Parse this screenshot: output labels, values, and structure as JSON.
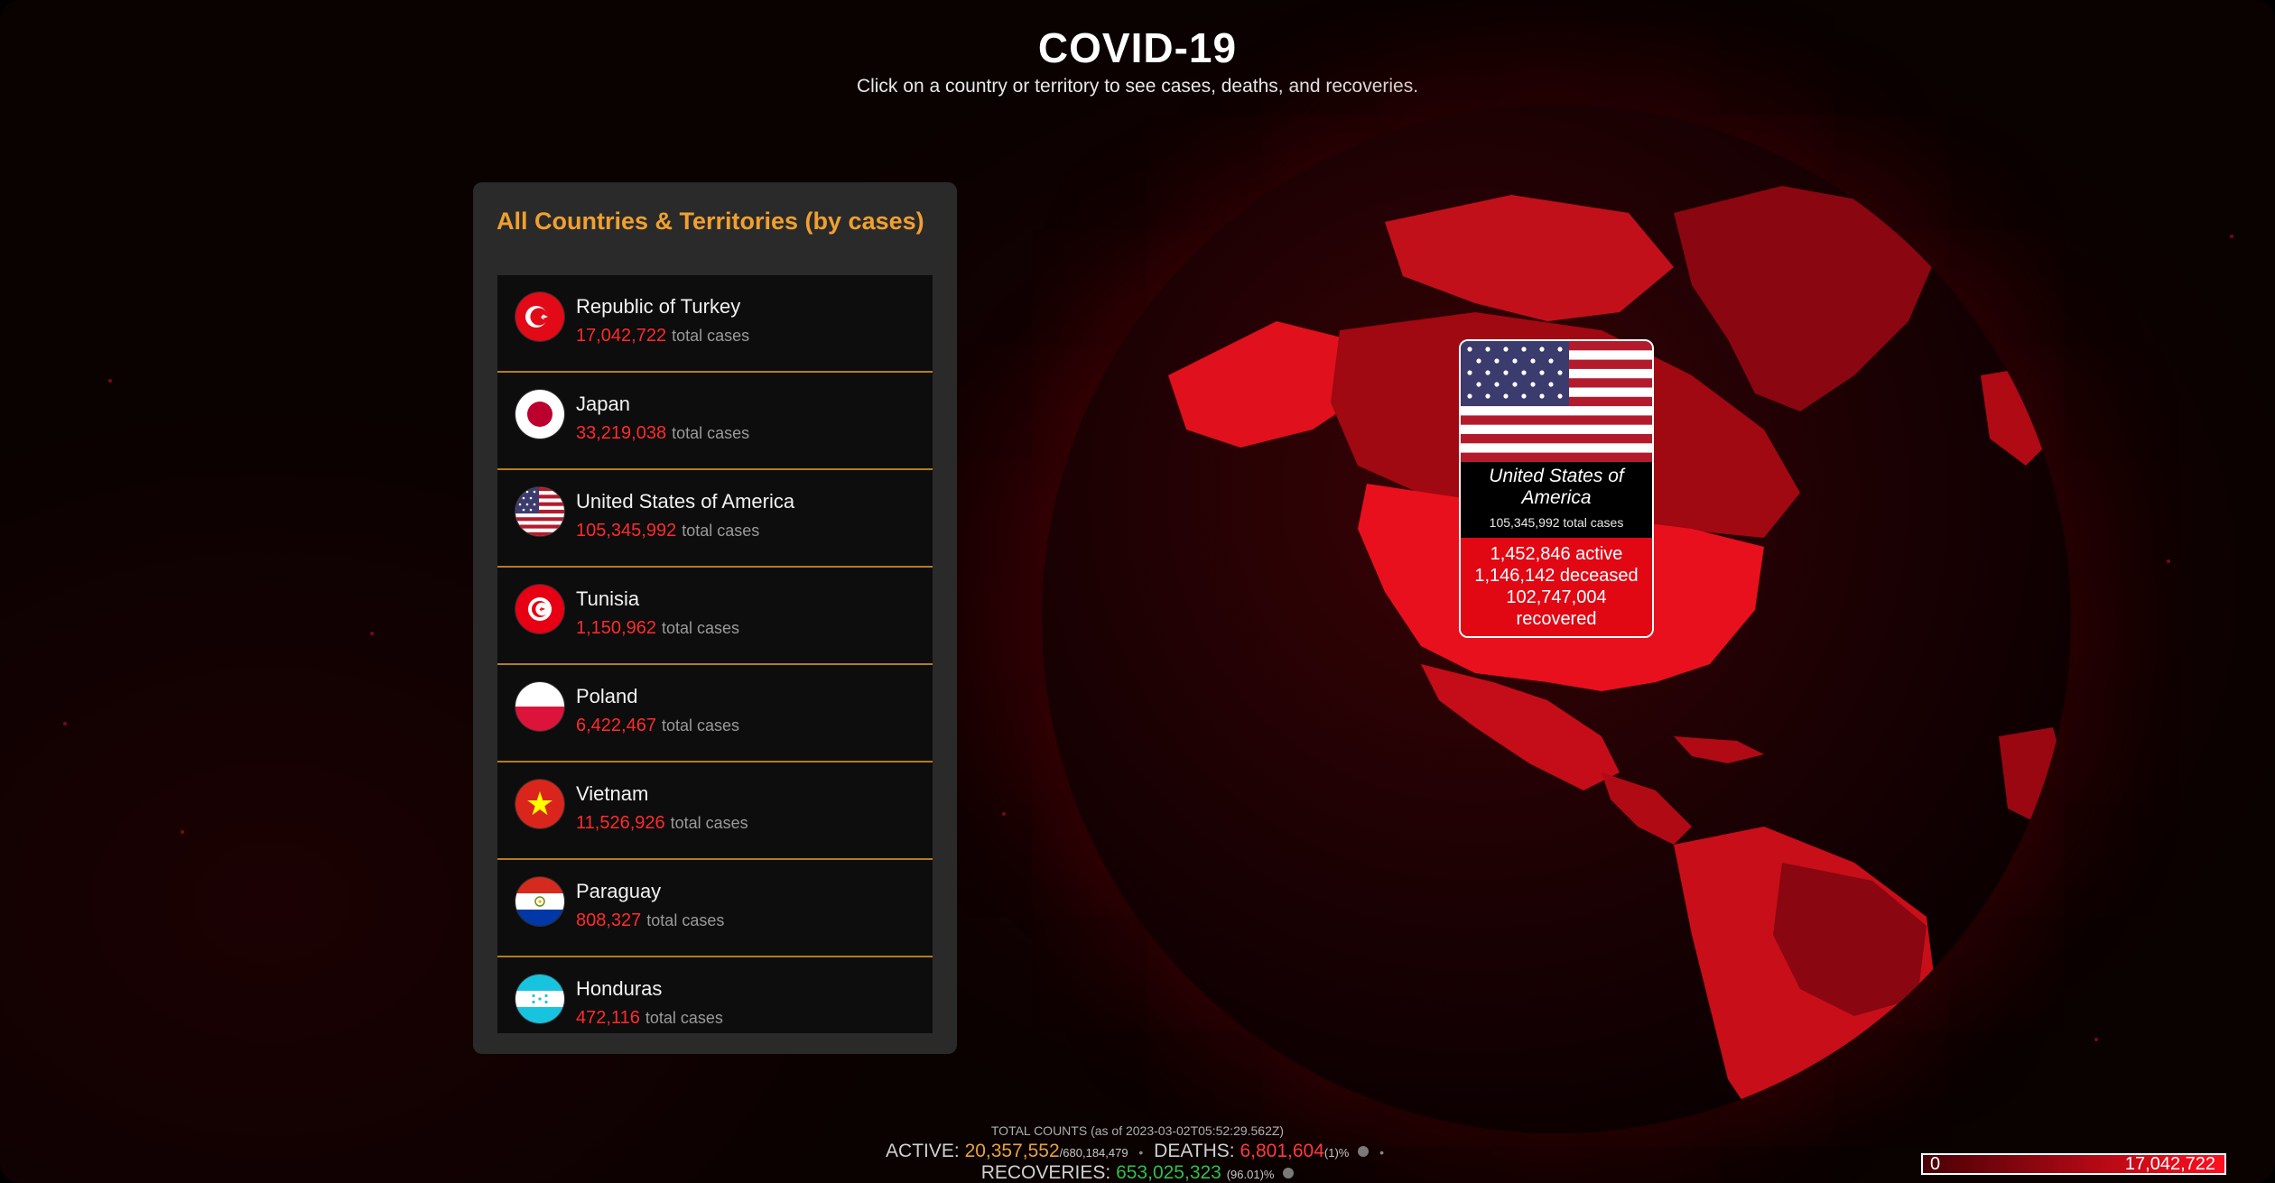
{
  "header": {
    "title": "COVID-19",
    "subtitle": "Click on a country or territory to see cases, deaths, and recoveries."
  },
  "panel": {
    "title": "All Countries & Territories (by cases)",
    "suffix": "total cases",
    "countries": [
      {
        "name": "Republic of Turkey",
        "cases": "17,042,722",
        "flag": "turkey-flag-icon"
      },
      {
        "name": "Japan",
        "cases": "33,219,038",
        "flag": "japan-flag-icon"
      },
      {
        "name": "United States of America",
        "cases": "105,345,992",
        "flag": "usa-flag-icon"
      },
      {
        "name": "Tunisia",
        "cases": "1,150,962",
        "flag": "tunisia-flag-icon"
      },
      {
        "name": "Poland",
        "cases": "6,422,467",
        "flag": "poland-flag-icon"
      },
      {
        "name": "Vietnam",
        "cases": "11,526,926",
        "flag": "vietnam-flag-icon"
      },
      {
        "name": "Paraguay",
        "cases": "808,327",
        "flag": "paraguay-flag-icon"
      },
      {
        "name": "Honduras",
        "cases": "472,116",
        "flag": "honduras-flag-icon"
      }
    ]
  },
  "tooltip": {
    "name": "United States of America",
    "total": "105,345,992 total cases",
    "active": "1,452,846 active",
    "deceased": "1,146,142 deceased",
    "recovered_value": "102,747,004",
    "recovered_label": "recovered"
  },
  "footer": {
    "label": "TOTAL COUNTS (as of 2023-03-02T05:52:29.562Z)",
    "active_label": "ACTIVE:",
    "active_value": "20,357,552",
    "active_total": "/680,184,479",
    "deaths_label": "DEATHS:",
    "deaths_value": "6,801,604",
    "deaths_pct": "(1)%",
    "recoveries_label": "RECOVERIES:",
    "recoveries_value": "653,025,323",
    "recoveries_pct": "(96.01)%"
  },
  "scale": {
    "min": "0",
    "max": "17,042,722"
  },
  "colors": {
    "accent": "#f0a030",
    "case_red": "#ff2b2b",
    "active": "#e8a23a",
    "recoveries": "#2fbf4a"
  }
}
